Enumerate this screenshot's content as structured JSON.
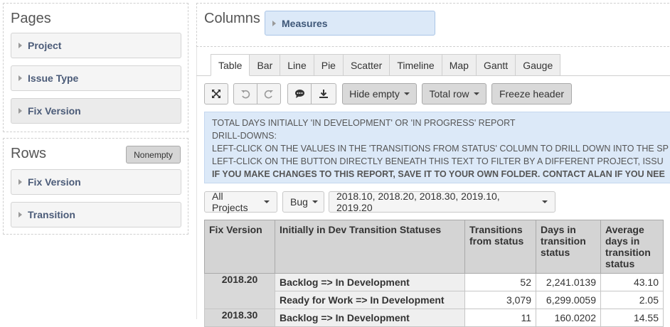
{
  "pages": {
    "title": "Pages",
    "items": [
      "Project",
      "Issue Type",
      "Fix Version"
    ]
  },
  "rows": {
    "title": "Rows",
    "nonempty_label": "Nonempty",
    "items": [
      "Fix Version",
      "Transition"
    ]
  },
  "columns": {
    "title": "Columns",
    "measures_label": "Measures"
  },
  "tabs": [
    "Table",
    "Bar",
    "Line",
    "Pie",
    "Scatter",
    "Timeline",
    "Map",
    "Gantt",
    "Gauge"
  ],
  "active_tab": "Table",
  "toolbar": {
    "expand_icon": "expand-icon",
    "undo_icon": "undo-icon",
    "redo_icon": "redo-icon",
    "comment_icon": "comment-icon",
    "download_icon": "download-icon",
    "hide_empty_label": "Hide empty",
    "total_row_label": "Total row",
    "freeze_header_label": "Freeze header"
  },
  "description": {
    "line1": "TOTAL DAYS INITIALLY 'IN DEVELOPMENT' OR 'IN PROGRESS' REPORT",
    "line2": "DRILL-DOWNS:",
    "line3": "LEFT-CLICK ON THE VALUES IN THE 'TRANSITIONS FROM STATUS' COLUMN TO DRILL DOWN INTO THE SP",
    "line4": "LEFT-CLICK ON THE BUTTON DIRECTLY BENEATH THIS TEXT TO FILTER BY A DIFFERENT PROJECT, ISSU",
    "line5": "IF YOU MAKE CHANGES TO THIS REPORT, SAVE IT TO YOUR OWN FOLDER. CONTACT ALAN IF YOU NEE"
  },
  "filters": {
    "project": "All Projects",
    "issue_type": "Bug",
    "fix_version": "2018.10, 2018.20, 2018.30, 2019.10, 2019.20"
  },
  "table": {
    "headers": {
      "fix_version": "Fix Version",
      "statuses": "Initially in Dev Transition Statuses",
      "transitions": "Transitions from status",
      "days": "Days in transition status",
      "avg": "Average days in transition status"
    },
    "rows": [
      {
        "fix_version": "2018.20",
        "transition": "Backlog => In Development",
        "transitions": "52",
        "days": "2,241.0139",
        "avg": "43.10"
      },
      {
        "fix_version": "",
        "transition": "Ready for Work => In Development",
        "transitions": "3,079",
        "days": "6,299.0059",
        "avg": "2.05"
      },
      {
        "fix_version": "2018.30",
        "transition": "Backlog => In Development",
        "transitions": "11",
        "days": "160.0202",
        "avg": "14.55"
      }
    ]
  }
}
